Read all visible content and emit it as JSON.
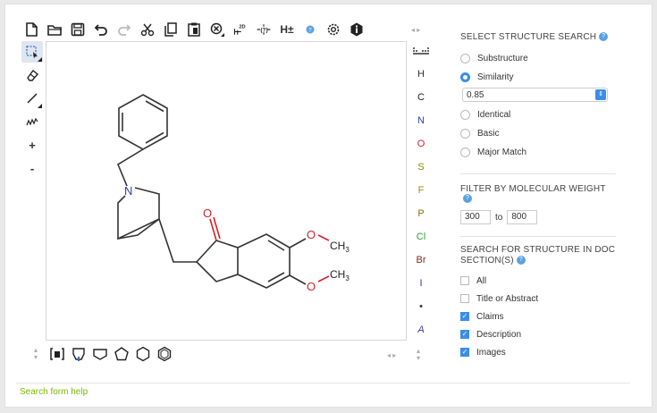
{
  "toolbar": {
    "items": [
      "new-document-icon",
      "open-folder-icon",
      "save-icon",
      "undo-icon",
      "redo-icon",
      "cut-icon",
      "copy-icon",
      "paste-icon",
      "erase-all-icon",
      "clean-2d-icon",
      "check-structure-icon",
      "explicit-hydrogens-icon",
      "help-info-icon",
      "settings-gear-icon",
      "about-icon"
    ],
    "clean2d_label": "2D",
    "hydrogen_label": "H±"
  },
  "left_tools": {
    "plus_label": "+",
    "minus_label": "-"
  },
  "elements": [
    "H",
    "C",
    "N",
    "O",
    "S",
    "F",
    "P",
    "Cl",
    "Br",
    "I",
    "•",
    "A"
  ],
  "element_colors": {
    "H": "#333333",
    "C": "#222222",
    "N": "#2f3fb0",
    "O": "#d2232a",
    "S": "#8a8a00",
    "F": "#b0861e",
    "P": "#9b6a10",
    "Cl": "#2ca02c",
    "Br": "#7b2a1a",
    "I": "#6a1aa0",
    "•": "#333333",
    "A": "#3a3aa0"
  },
  "molecule": {
    "o_ketone": "O",
    "n_label": "N",
    "o_methoxy1": "O",
    "o_methoxy2": "O",
    "ch3_1": "CH",
    "ch3_2": "CH",
    "sub_3": "3"
  },
  "search": {
    "title": "SELECT STRUCTURE SEARCH",
    "options": [
      "Substructure",
      "Similarity",
      "Identical",
      "Basic",
      "Major Match"
    ],
    "selected": "Similarity",
    "similarity_value": "0.85"
  },
  "weight": {
    "title": "FILTER BY MOLECULAR WEIGHT",
    "min": "300",
    "to_label": "to",
    "max": "800"
  },
  "sections": {
    "title_line1": "SEARCH FOR STRUCTURE IN DOC",
    "title_line2": "SECTION(S)",
    "items": [
      {
        "label": "All",
        "checked": false
      },
      {
        "label": "Title or Abstract",
        "checked": false
      },
      {
        "label": "Claims",
        "checked": true
      },
      {
        "label": "Description",
        "checked": true
      },
      {
        "label": "Images",
        "checked": true
      }
    ]
  },
  "footer": {
    "help_link": "Search form help"
  },
  "colors": {
    "accent": "#3a8ee6",
    "link": "#7ab800",
    "nitrogen": "#2f3fb0",
    "oxygen": "#d2232a"
  }
}
